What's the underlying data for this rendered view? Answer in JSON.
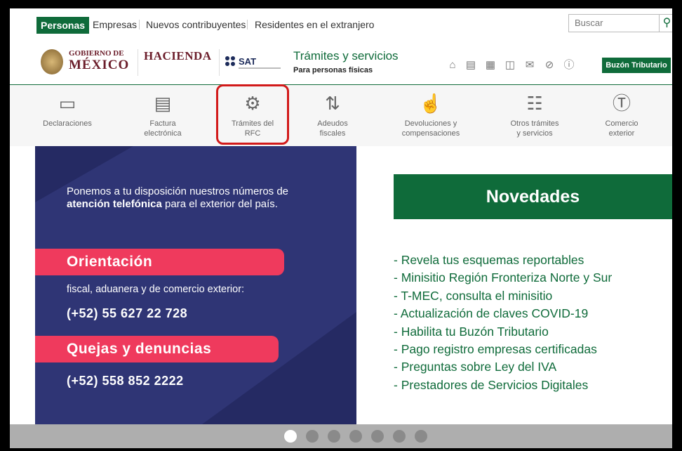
{
  "topnav": {
    "items": [
      "Personas",
      "Empresas",
      "Nuevos contribuyentes",
      "Residentes en el extranjero"
    ],
    "search_placeholder": "Buscar",
    "search_icon": "search-icon"
  },
  "header": {
    "gob_line1": "GOBIERNO DE",
    "gob_line2": "MÉXICO",
    "hacienda": "HACIENDA",
    "sat": "SAT",
    "title": "Trámites y servicios",
    "subtitle": "Para personas físicas",
    "icons": [
      "home-icon",
      "id-card-icon",
      "calendar-icon",
      "book-icon",
      "mail-icon",
      "compass-icon",
      "help-icon"
    ],
    "buzon": "Buzón Tributario"
  },
  "menu": {
    "items": [
      {
        "label": "Declaraciones",
        "icon": "declaraciones-icon"
      },
      {
        "label": "Factura\nelectrónica",
        "icon": "invoice-icon"
      },
      {
        "label": "Trámites del\nRFC",
        "icon": "rfc-icon"
      },
      {
        "label": "Adeudos\nfiscales",
        "icon": "debt-icon"
      },
      {
        "label": "Devoluciones y\ncompensaciones",
        "icon": "refund-icon"
      },
      {
        "label": "Otros trámites\ny servicios",
        "icon": "chart-icon"
      },
      {
        "label": "Comercio\nexterior",
        "icon": "coin-icon"
      }
    ]
  },
  "banner": {
    "intro_1": "Ponemos a tu disposición nuestros números de ",
    "intro_bold": "atención telefónica",
    "intro_2": " para el exterior del país.",
    "orientacion": "Orientación",
    "fiscal": "fiscal, aduanera y de comercio exterior:",
    "phone1": "(+52)  55 627 22 728",
    "quejas": "Quejas y denuncias",
    "phone2": "(+52)  558 852 2222"
  },
  "novedades": {
    "title": "Novedades",
    "items": [
      "- Revela tus esquemas reportables",
      "- Minisitio Región Fronteriza Norte y Sur",
      "- T-MEC, consulta el minisitio",
      "- Actualización de claves COVID-19",
      "- Habilita tu Buzón Tributario",
      "- Pago registro empresas certificadas",
      "- Preguntas sobre Ley del IVA",
      "- Prestadores de Servicios Digitales"
    ]
  },
  "carousel": {
    "count": 7,
    "active": 0
  },
  "colors": {
    "brand_green": "#0f6b3a",
    "guinda": "#6b1d2a",
    "banner_blue": "#2f3575",
    "pink": "#ef3a5d",
    "highlight_red": "#d21a1a"
  }
}
